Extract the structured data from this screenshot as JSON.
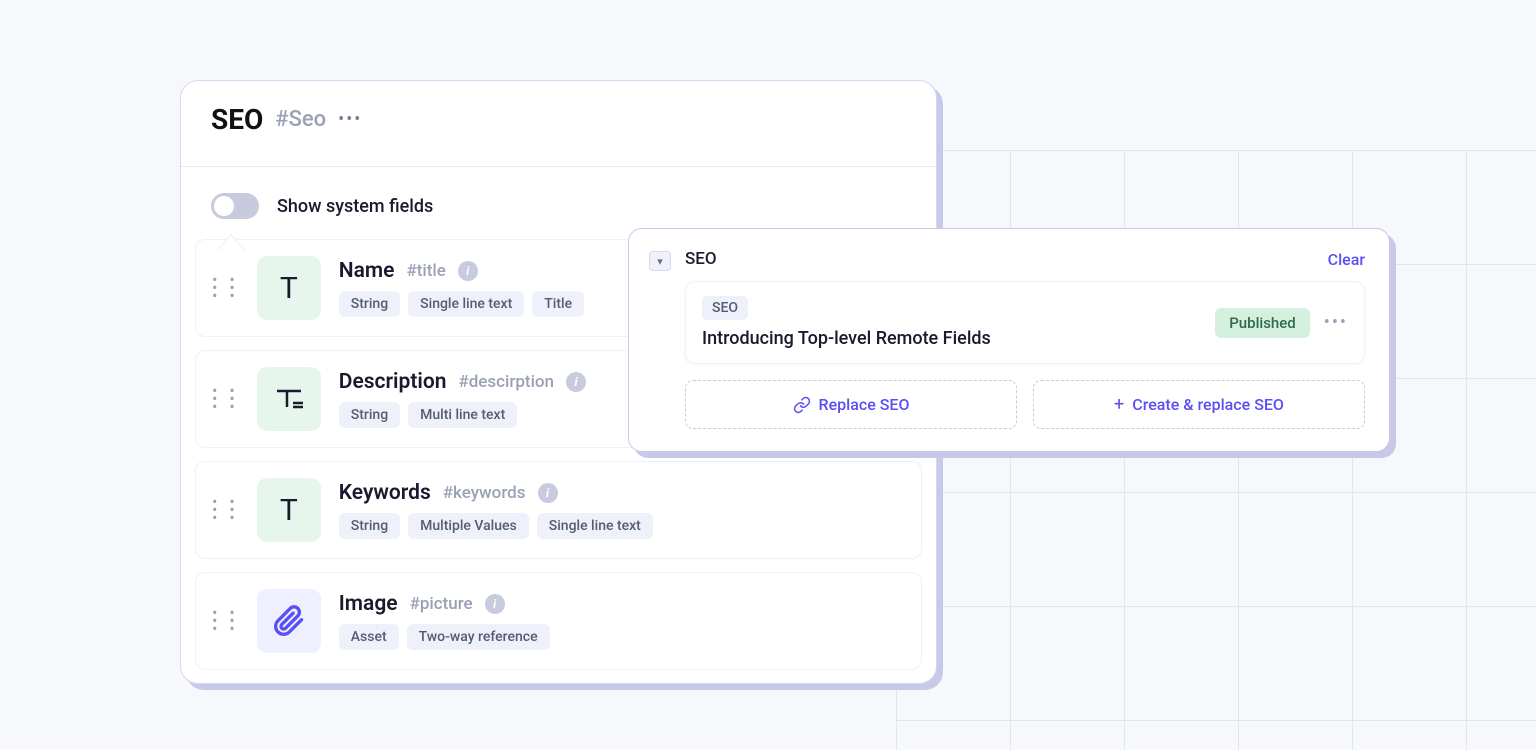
{
  "panel": {
    "title": "SEO",
    "hash": "#Seo",
    "toggleLabel": "Show system fields"
  },
  "fields": [
    {
      "name": "Name",
      "hash": "#title",
      "icon": "text",
      "tags": [
        "String",
        "Single line text",
        "Title"
      ]
    },
    {
      "name": "Description",
      "hash": "#descirption",
      "icon": "text-multi",
      "tags": [
        "String",
        "Multi line text"
      ]
    },
    {
      "name": "Keywords",
      "hash": "#keywords",
      "icon": "text",
      "tags": [
        "String",
        "Multiple Values",
        "Single line text"
      ]
    },
    {
      "name": "Image",
      "hash": "#picture",
      "icon": "asset",
      "tags": [
        "Asset",
        "Two-way reference"
      ]
    }
  ],
  "floatCard": {
    "title": "SEO",
    "clear": "Clear",
    "entry": {
      "typeTag": "SEO",
      "title": "Introducing Top-level Remote Fields",
      "status": "Published"
    },
    "replaceLabel": "Replace SEO",
    "createReplaceLabel": "Create & replace SEO"
  }
}
